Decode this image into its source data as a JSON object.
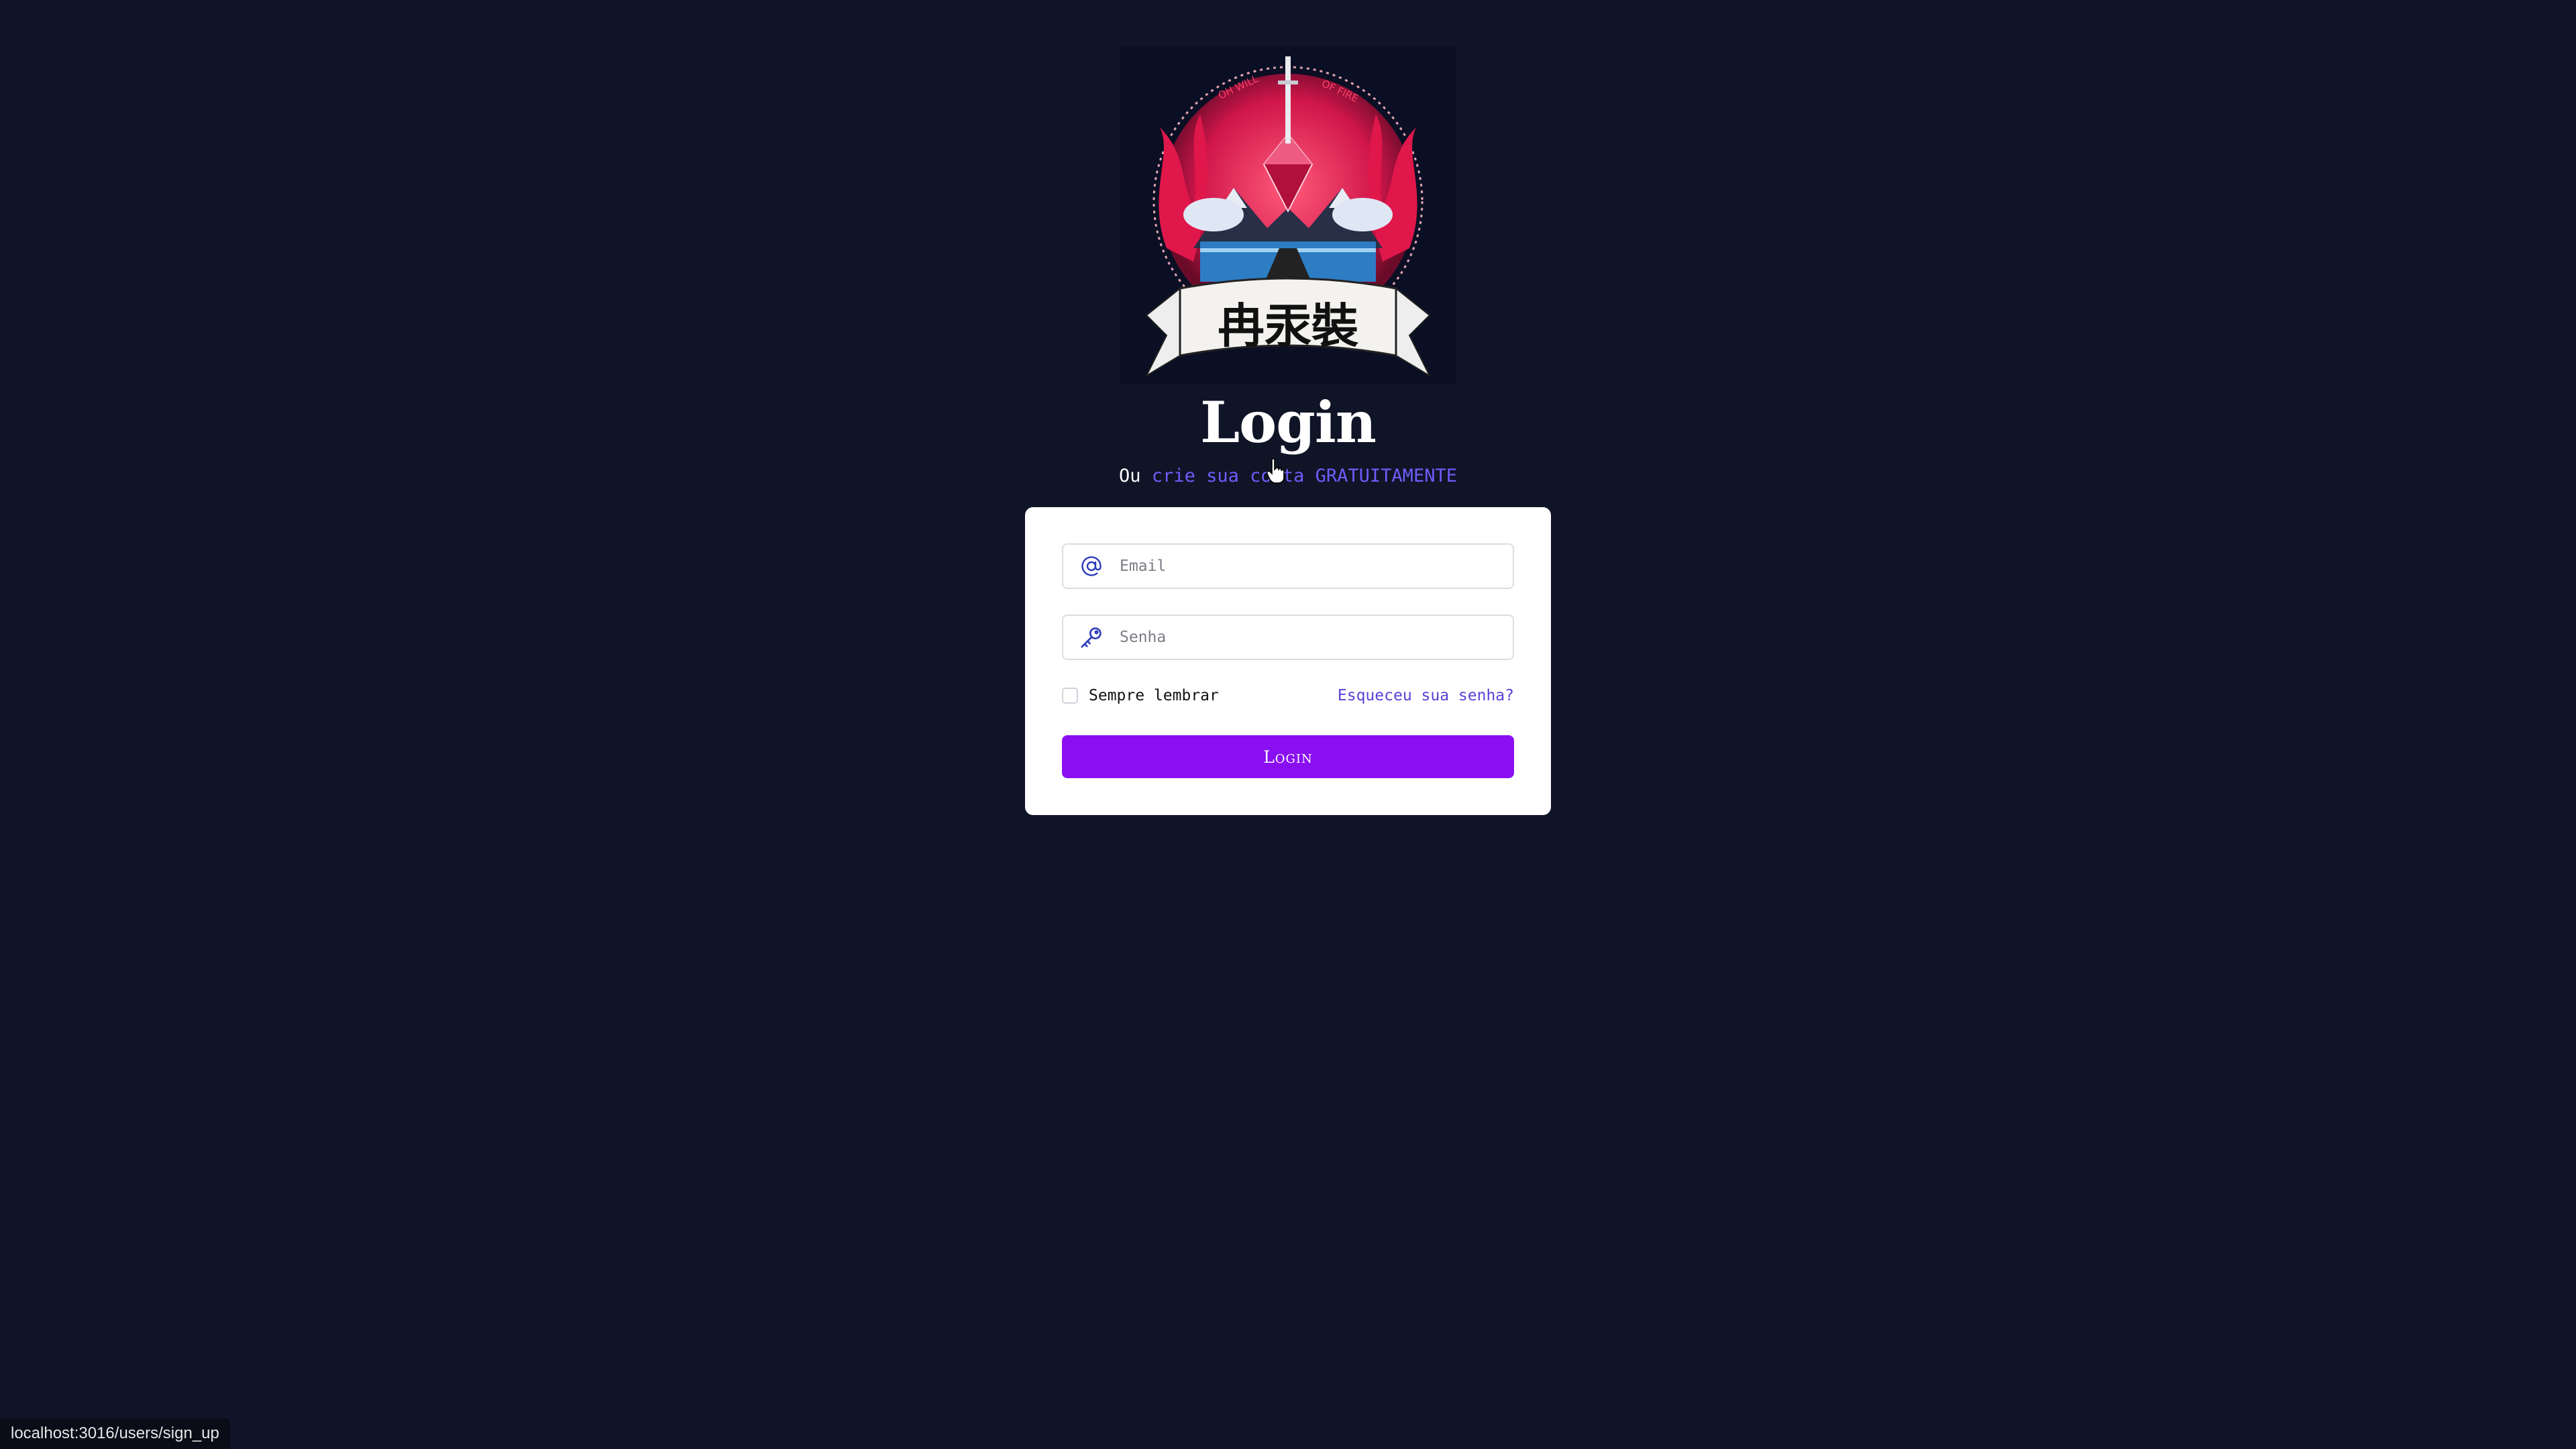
{
  "logo": {
    "alt": "Will of Fire emblem",
    "arc_text_left": "OH WILL",
    "arc_text_right": "OF FIRE",
    "banner_text": "冉汞裝"
  },
  "page": {
    "title": "Login",
    "subtitle_prefix": "Ou ",
    "signup_link": "crie sua conta GRATUITAMENTE"
  },
  "form": {
    "email_placeholder": "Email",
    "email_icon": "at-icon",
    "password_placeholder": "Senha",
    "password_icon": "key-icon",
    "remember_label": "Sempre lembrar",
    "remember_checked": false,
    "forgot_link": "Esqueceu sua senha?",
    "submit_label": "Login"
  },
  "statusbar": {
    "url": "localhost:3016/users/sign_up"
  },
  "colors": {
    "background": "#0f1427",
    "accent": "#8a0ff0",
    "link": "#6d5dfc"
  }
}
